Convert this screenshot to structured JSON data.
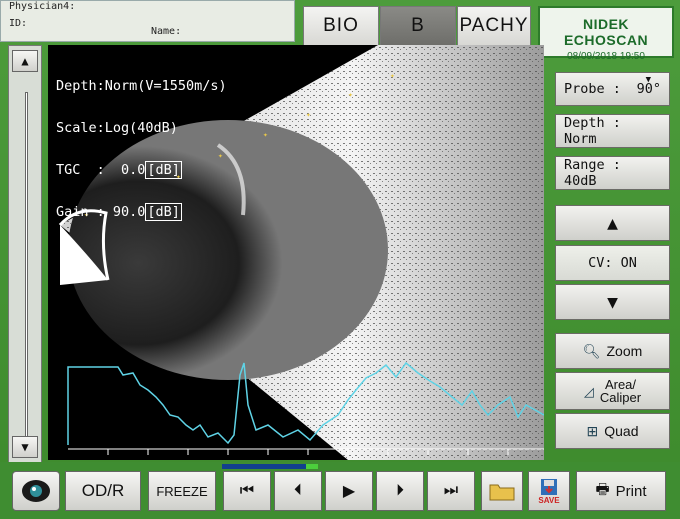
{
  "header": {
    "physician_label": "Physician4:",
    "id_label": "ID:",
    "name_label": "Name:",
    "tabs": [
      "BIO",
      "B",
      "PACHY"
    ],
    "active_tab": "B",
    "brand": "NIDEK ECHOSCAN",
    "date": "08/09/2018 19:50"
  },
  "scan_info": {
    "depth": "Depth:Norm(V=1550m/s)",
    "scale": "Scale:Log(40dB)",
    "tgc_label": "TGC  :  0.0",
    "gain_label": "Gain : 90.0",
    "unit": "[dB]"
  },
  "right_panel": {
    "probe_label": "Probe :",
    "probe_value": "90°",
    "depth_label": "Depth : Norm",
    "range_label": "Range : 40dB",
    "cv_label": "CV: ON",
    "zoom_label": "Zoom",
    "area_label_1": "Area/",
    "area_label_2": "Caliper",
    "quad_label": "Quad"
  },
  "bottom_bar": {
    "odr_label": "OD/R",
    "freeze_label": "FREEZE",
    "save_label": "SAVE",
    "print_label": "Print"
  },
  "colors": {
    "frame": "#3f8d31",
    "a_scan": "#5fd3e6",
    "brand_text": "#1c6b2a"
  }
}
